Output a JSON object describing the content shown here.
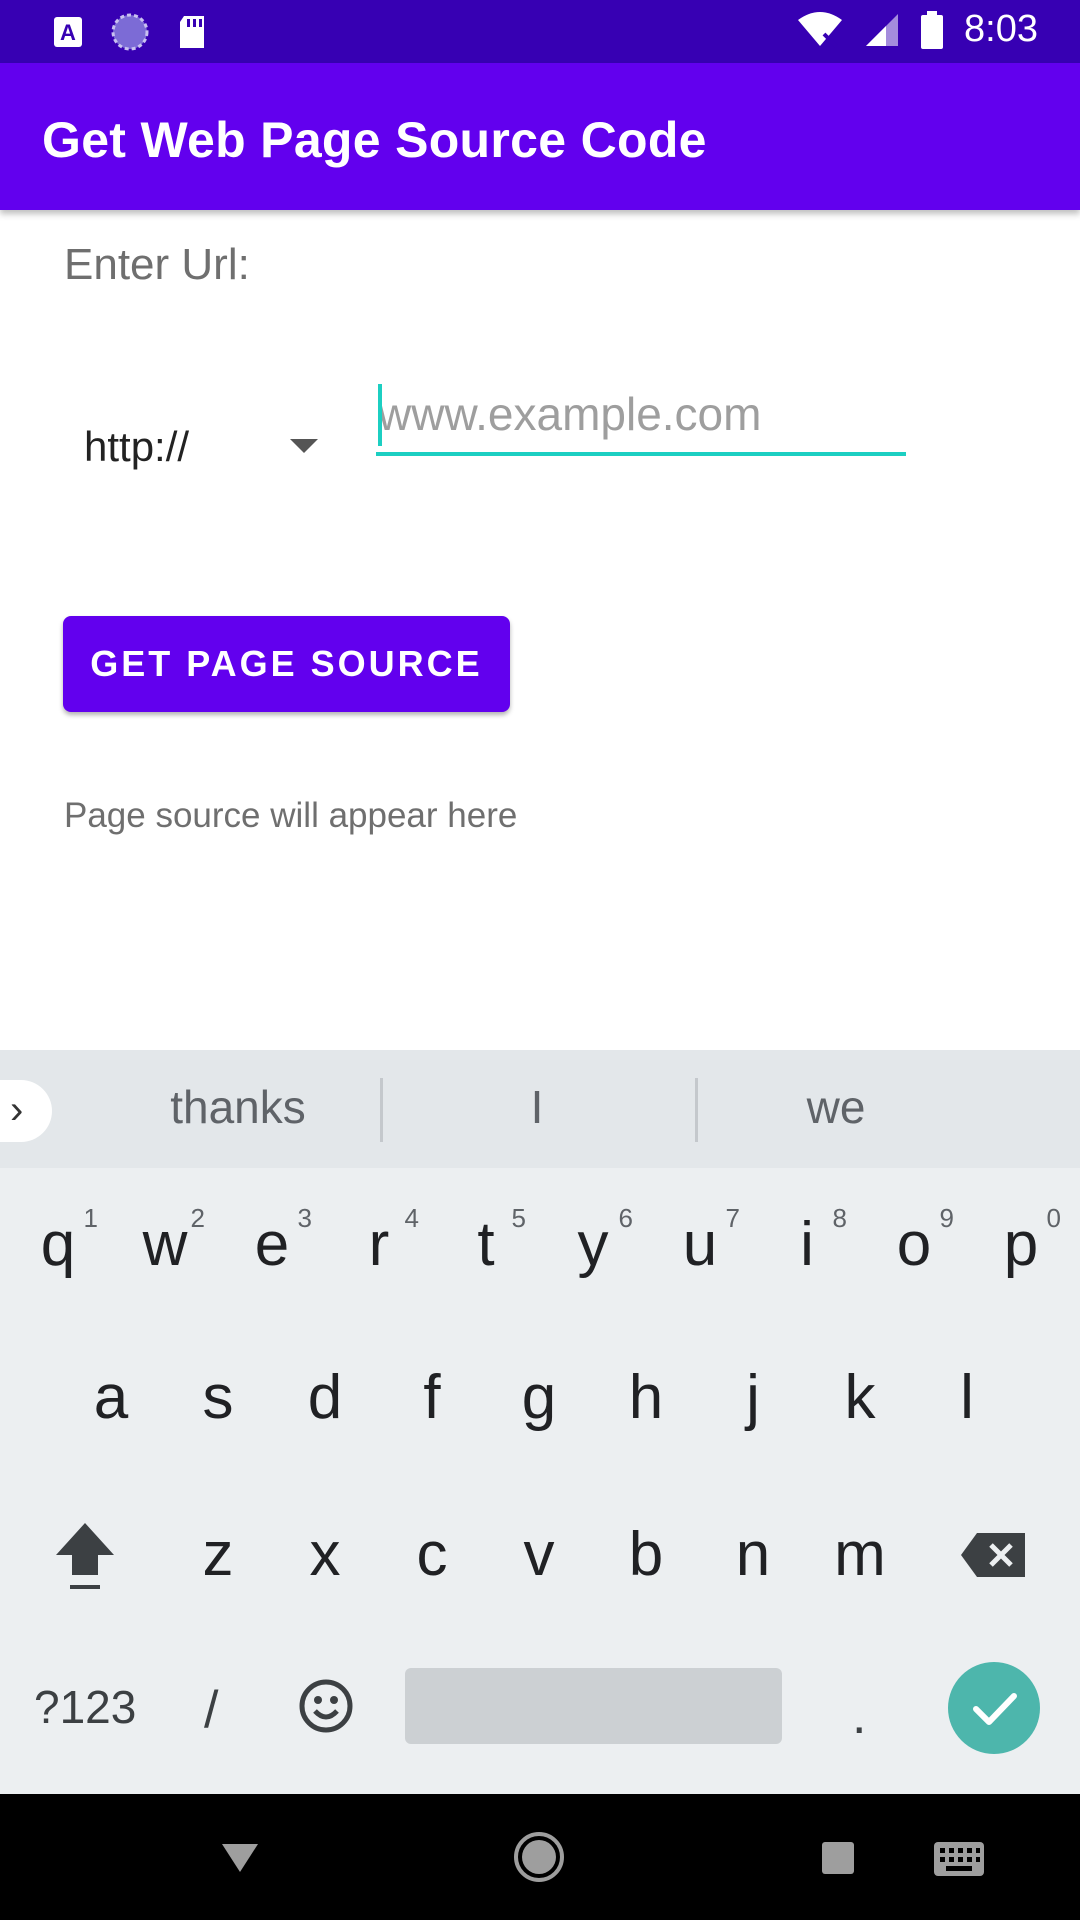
{
  "status_bar": {
    "time": "8:03",
    "left_icons": [
      "accessibility-a-icon",
      "sync-circle-icon",
      "sd-card-icon"
    ],
    "right_icons": [
      "wifi-off-icon",
      "cell-signal-icon",
      "battery-icon"
    ]
  },
  "app_bar": {
    "title": "Get Web Page Source Code"
  },
  "form": {
    "label": "Enter Url:",
    "protocol_selected": "http://",
    "url_placeholder": "www.example.com",
    "url_value": "",
    "button_label": "GET PAGE SOURCE"
  },
  "result": {
    "text": "Page source will appear here"
  },
  "keyboard": {
    "suggestions": [
      "thanks",
      "I",
      "we"
    ],
    "row1": [
      {
        "k": "q",
        "h": "1"
      },
      {
        "k": "w",
        "h": "2"
      },
      {
        "k": "e",
        "h": "3"
      },
      {
        "k": "r",
        "h": "4"
      },
      {
        "k": "t",
        "h": "5"
      },
      {
        "k": "y",
        "h": "6"
      },
      {
        "k": "u",
        "h": "7"
      },
      {
        "k": "i",
        "h": "8"
      },
      {
        "k": "o",
        "h": "9"
      },
      {
        "k": "p",
        "h": "0"
      }
    ],
    "row2": [
      "a",
      "s",
      "d",
      "f",
      "g",
      "h",
      "j",
      "k",
      "l"
    ],
    "row3": [
      "z",
      "x",
      "c",
      "v",
      "b",
      "n",
      "m"
    ],
    "symbols_label": "?123",
    "slash_label": "/",
    "period_label": ".",
    "enter_color": "#4db6ac"
  },
  "colors": {
    "primary": "#6200ee",
    "primary_dark": "#3700b3",
    "accent": "#1ccfc2"
  }
}
